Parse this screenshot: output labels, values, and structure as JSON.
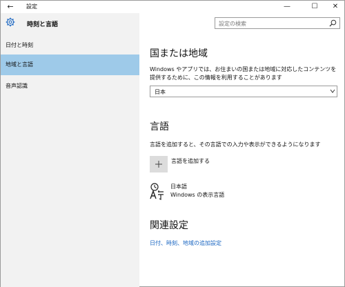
{
  "window": {
    "title": "設定",
    "back_glyph": "←",
    "minimize_glyph": "—",
    "maximize_glyph": "☐",
    "close_glyph": "✕"
  },
  "sidebar": {
    "header_title": "時刻と言語",
    "header_icon": "gear-icon",
    "items": [
      {
        "label": "日付と時刻",
        "selected": false
      },
      {
        "label": "地域と言語",
        "selected": true
      },
      {
        "label": "音声認識",
        "selected": false
      }
    ]
  },
  "search": {
    "placeholder": "設定の検索",
    "icon": "search-icon"
  },
  "region": {
    "heading": "国または地域",
    "description_line1": "Windows やアプリでは、お住まいの国または地域に対応したコンテンツを",
    "description_line2": "提供するために、この情報を利用することがあります",
    "selected_value": "日本"
  },
  "language": {
    "heading": "言語",
    "description": "言語を追加すると、その言語での入力や表示ができるようになります",
    "add_icon": "+",
    "add_label": "言語を追加する",
    "installed": [
      {
        "name": "日本語",
        "detail": "Windows の表示言語",
        "icon": "language-icon"
      }
    ]
  },
  "related": {
    "heading": "関連設定",
    "link": "日付、時刻、地域の追加設定"
  },
  "colors": {
    "accent": "#1a66c2",
    "selected_bg": "#9ecae9",
    "sidebar_bg": "#f2f2f2"
  }
}
